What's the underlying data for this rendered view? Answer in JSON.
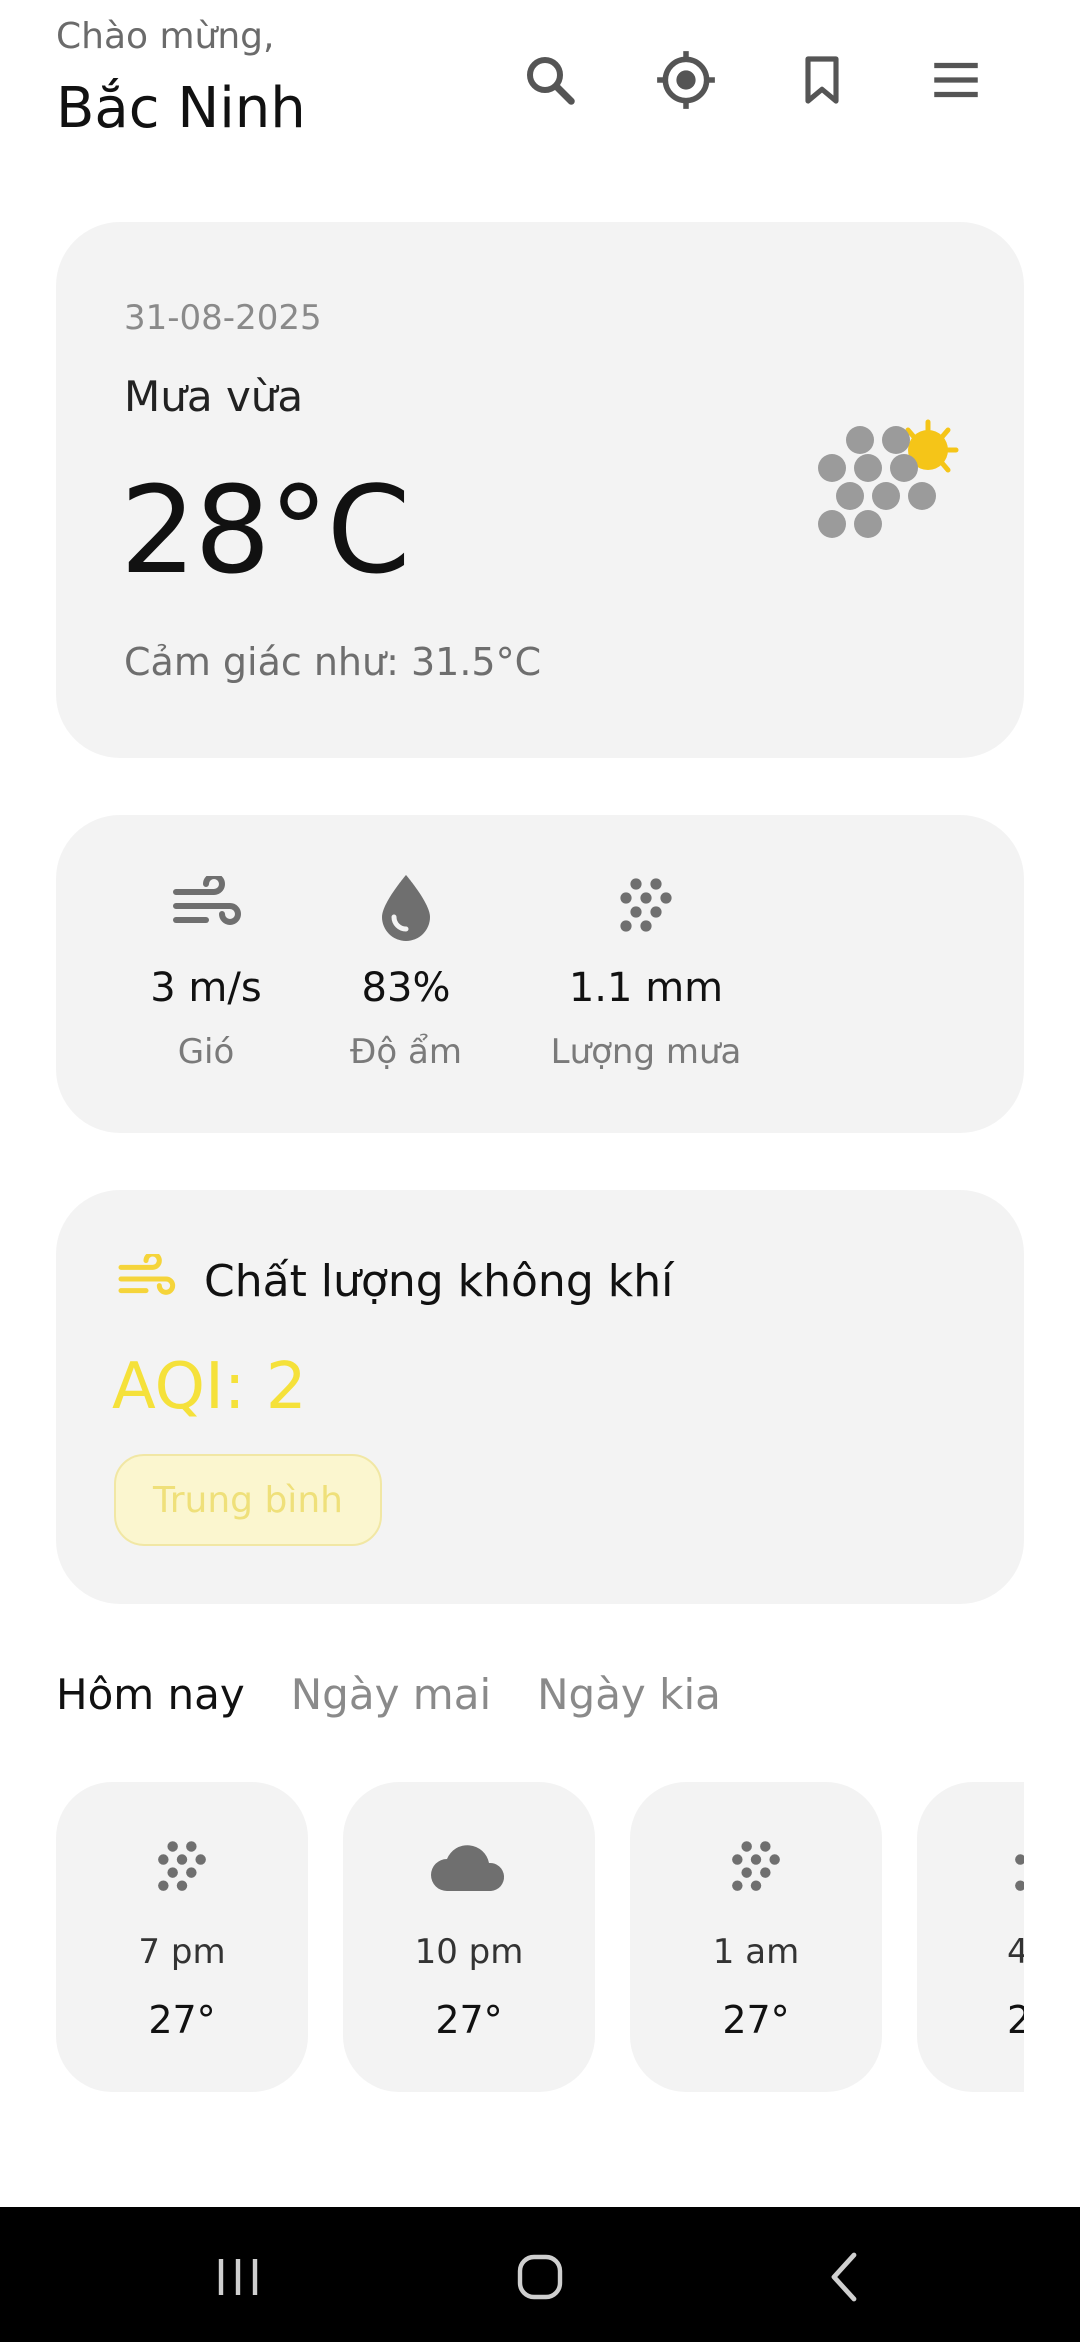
{
  "header": {
    "greeting": "Chào mừng,",
    "city": "Bắc Ninh",
    "icons": [
      "search-icon",
      "location-target-icon",
      "bookmark-icon",
      "menu-icon"
    ]
  },
  "current": {
    "date": "31-08-2025",
    "condition": "Mưa vừa",
    "temperature": "28°C",
    "feels_like": "Cảm giác như: 31.5°C",
    "icon": "rain-sun-icon"
  },
  "stats": [
    {
      "icon": "wind-icon",
      "value": "3 m/s",
      "label": "Gió"
    },
    {
      "icon": "humidity-drop-icon",
      "value": "83%",
      "label": "Độ ẩm"
    },
    {
      "icon": "rain-dots-icon",
      "value": "1.1 mm",
      "label": "Lượng mưa"
    }
  ],
  "aqi": {
    "title": "Chất lượng không khí",
    "value": "AQI: 2",
    "status": "Trung bình",
    "color": "#f5e13a"
  },
  "tabs": [
    "Hôm nay",
    "Ngày mai",
    "Ngày kia"
  ],
  "hourly": [
    {
      "time": "7 pm",
      "temp": "27°",
      "icon": "rain-dots-icon"
    },
    {
      "time": "10 pm",
      "temp": "27°",
      "icon": "cloud-icon"
    },
    {
      "time": "1 am",
      "temp": "27°",
      "icon": "rain-dots-icon"
    },
    {
      "time": "4",
      "temp": "2",
      "icon": "rain-dots-icon"
    }
  ],
  "colors": {
    "card_bg": "#f3f3f3",
    "icon_gray": "#6f6f6f",
    "sun": "#f5c518",
    "aqi_yellow": "#f5e13a"
  }
}
